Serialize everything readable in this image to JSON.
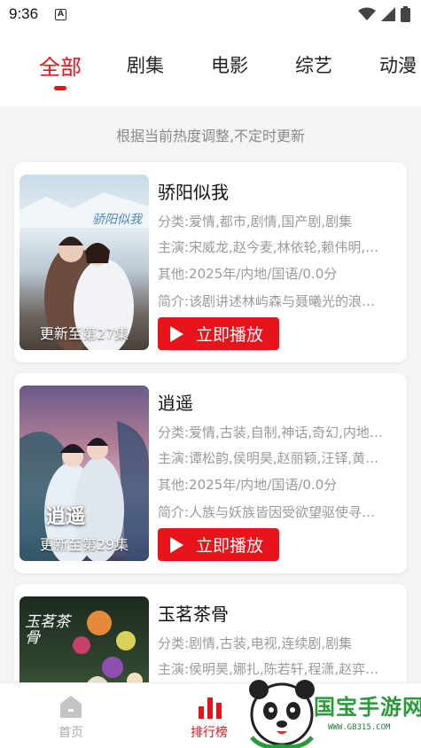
{
  "status_bar": {
    "time": "9:36",
    "notif_letter": "A"
  },
  "tabs": [
    {
      "label": "全部",
      "active": true
    },
    {
      "label": "剧集"
    },
    {
      "label": "电影"
    },
    {
      "label": "综艺"
    },
    {
      "label": "动漫"
    }
  ],
  "notice": "根据当前热度调整,不定时更新",
  "items": [
    {
      "title": "骄阳似我",
      "episode": "更新至第27集",
      "category": "分类:爱情,都市,剧情,国产剧,剧集",
      "cast": "主演:宋威龙,赵今麦,林依轮,赖伟明,…",
      "other": "其他:2025年/内地/国语/0.0分",
      "intro": "简介:该剧讲述林屿森与聂曦光的浪…",
      "play": "立即播放",
      "poster_art": "骄阳似我"
    },
    {
      "title": "逍遥",
      "episode": "更新至第29集",
      "category": "分类:爱情,古装,自制,神话,奇幻,内地…",
      "cast": "主演:谭松韵,侯明昊,赵丽颖,汪铎,黄…",
      "other": "其他:2025年/内地/国语/0.0分",
      "intro": "简介:人族与妖族皆因受欲望驱使寻…",
      "play": "立即播放",
      "poster_art": "逍遥"
    },
    {
      "title": "玉茗茶骨",
      "category": "分类:剧情,古装,电视,连续剧,剧集",
      "cast": "主演:侯明昊,娜扎,陈若轩,程潇,赵弈…",
      "poster_art": "玉茗茶骨"
    }
  ],
  "bottom_nav": [
    {
      "label": "首页",
      "icon": "home-icon",
      "active": false
    },
    {
      "label": "排行榜",
      "icon": "ranking-icon",
      "active": true
    }
  ],
  "watermark": {
    "text": "国宝手游网",
    "url": "WWW.GB315.COM"
  },
  "colors": {
    "accent": "#e5151b",
    "meta_text": "#9a9a9a",
    "watermark": "#2a9a3a"
  }
}
